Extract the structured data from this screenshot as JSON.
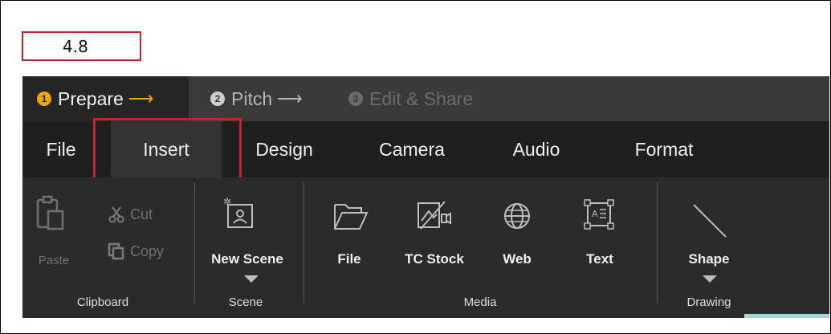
{
  "step_indicator": {
    "value": "4.8"
  },
  "progress_steps": [
    {
      "number": "1",
      "label": "Prepare"
    },
    {
      "number": "2",
      "label": "Pitch"
    },
    {
      "number": "3",
      "label": "Edit & Share"
    }
  ],
  "arrow_glyph": "⟶",
  "menu": [
    "File",
    "Insert",
    "Design",
    "Camera",
    "Audio",
    "Format"
  ],
  "ribbon": {
    "clipboard": {
      "group_label": "Clipboard",
      "paste": "Paste",
      "cut": "Cut",
      "copy": "Copy"
    },
    "scene": {
      "group_label": "Scene",
      "new_scene": "New Scene"
    },
    "media": {
      "group_label": "Media",
      "file": "File",
      "tc_stock": "TC Stock",
      "web": "Web",
      "text": "Text"
    },
    "drawing": {
      "group_label": "Drawing",
      "shape": "Shape"
    }
  },
  "colors": {
    "accent_orange": "#f0a400",
    "highlight_red": "#c0272d",
    "ribbon_bg": "#2b2b2b",
    "menu_bg": "#1f1f1f"
  },
  "icons": [
    "paste-icon",
    "scissors-icon",
    "copy-icon",
    "new-scene-icon",
    "folder-icon",
    "tc-stock-icon",
    "globe-icon",
    "text-box-icon",
    "line-shape-icon",
    "chevron-down-icon"
  ]
}
